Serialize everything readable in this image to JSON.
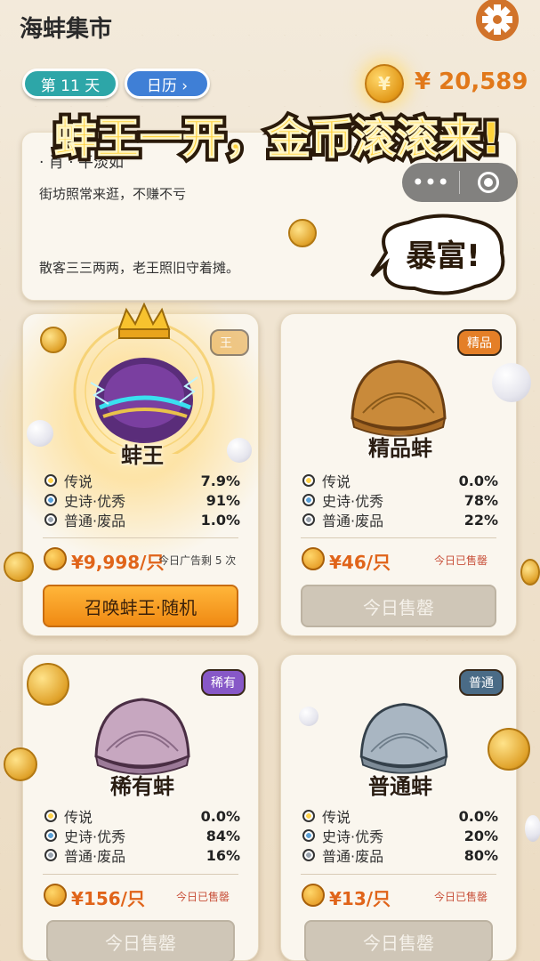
{
  "header": {
    "title": "海蚌集市",
    "day_label": "第 11 天",
    "calendar_label": "日历 ›",
    "coin_symbol": "¥",
    "money": "¥ 20,589"
  },
  "banner": {
    "headline": "蚌王一开，金币滚滚来!",
    "bubble": "暴富!"
  },
  "notice": {
    "title": "· 肖 · 平淡如",
    "line1": "街坊照常来逛，不赚不亏",
    "line2": "散客三三两两，老王照旧守着摊。"
  },
  "mini_program": {
    "menu_icon": "more-dots-icon",
    "close_icon": "target-icon"
  },
  "cards": [
    {
      "name": "蚌王",
      "tag": "王",
      "odds": [
        {
          "label": "传说",
          "value": "7.9%"
        },
        {
          "label": "史诗·优秀",
          "value": "91%"
        },
        {
          "label": "普通·废品",
          "value": "1.0%"
        }
      ],
      "price": "¥9,998/只",
      "note": "今日广告剩 5 次",
      "button": "召唤蚌王·随机"
    },
    {
      "name": "精品蚌",
      "tag": "精品",
      "odds": [
        {
          "label": "传说",
          "value": "0.0%"
        },
        {
          "label": "史诗·优秀",
          "value": "78%"
        },
        {
          "label": "普通·废品",
          "value": "22%"
        }
      ],
      "price": "¥46/只",
      "note": "今日已售罄",
      "button": "今日售罄"
    },
    {
      "name": "稀有蚌",
      "tag": "稀有",
      "odds": [
        {
          "label": "传说",
          "value": "0.0%"
        },
        {
          "label": "史诗·优秀",
          "value": "84%"
        },
        {
          "label": "普通·废品",
          "value": "16%"
        }
      ],
      "price": "¥156/只",
      "note": "今日已售罄",
      "button": "今日售罄"
    },
    {
      "name": "普通蚌",
      "tag": "普通",
      "odds": [
        {
          "label": "传说",
          "value": "0.0%"
        },
        {
          "label": "史诗·优秀",
          "value": "20%"
        },
        {
          "label": "普通·废品",
          "value": "80%"
        }
      ],
      "price": "¥13/只",
      "note": "今日已售罄",
      "button": "今日售罄"
    }
  ],
  "colors": {
    "accent_orange": "#e1781a",
    "price_orange": "#e0641a",
    "teal": "#2da6a8",
    "blue": "#3f7fd6",
    "purple": "#8758c7",
    "slate": "#4a6b86"
  }
}
